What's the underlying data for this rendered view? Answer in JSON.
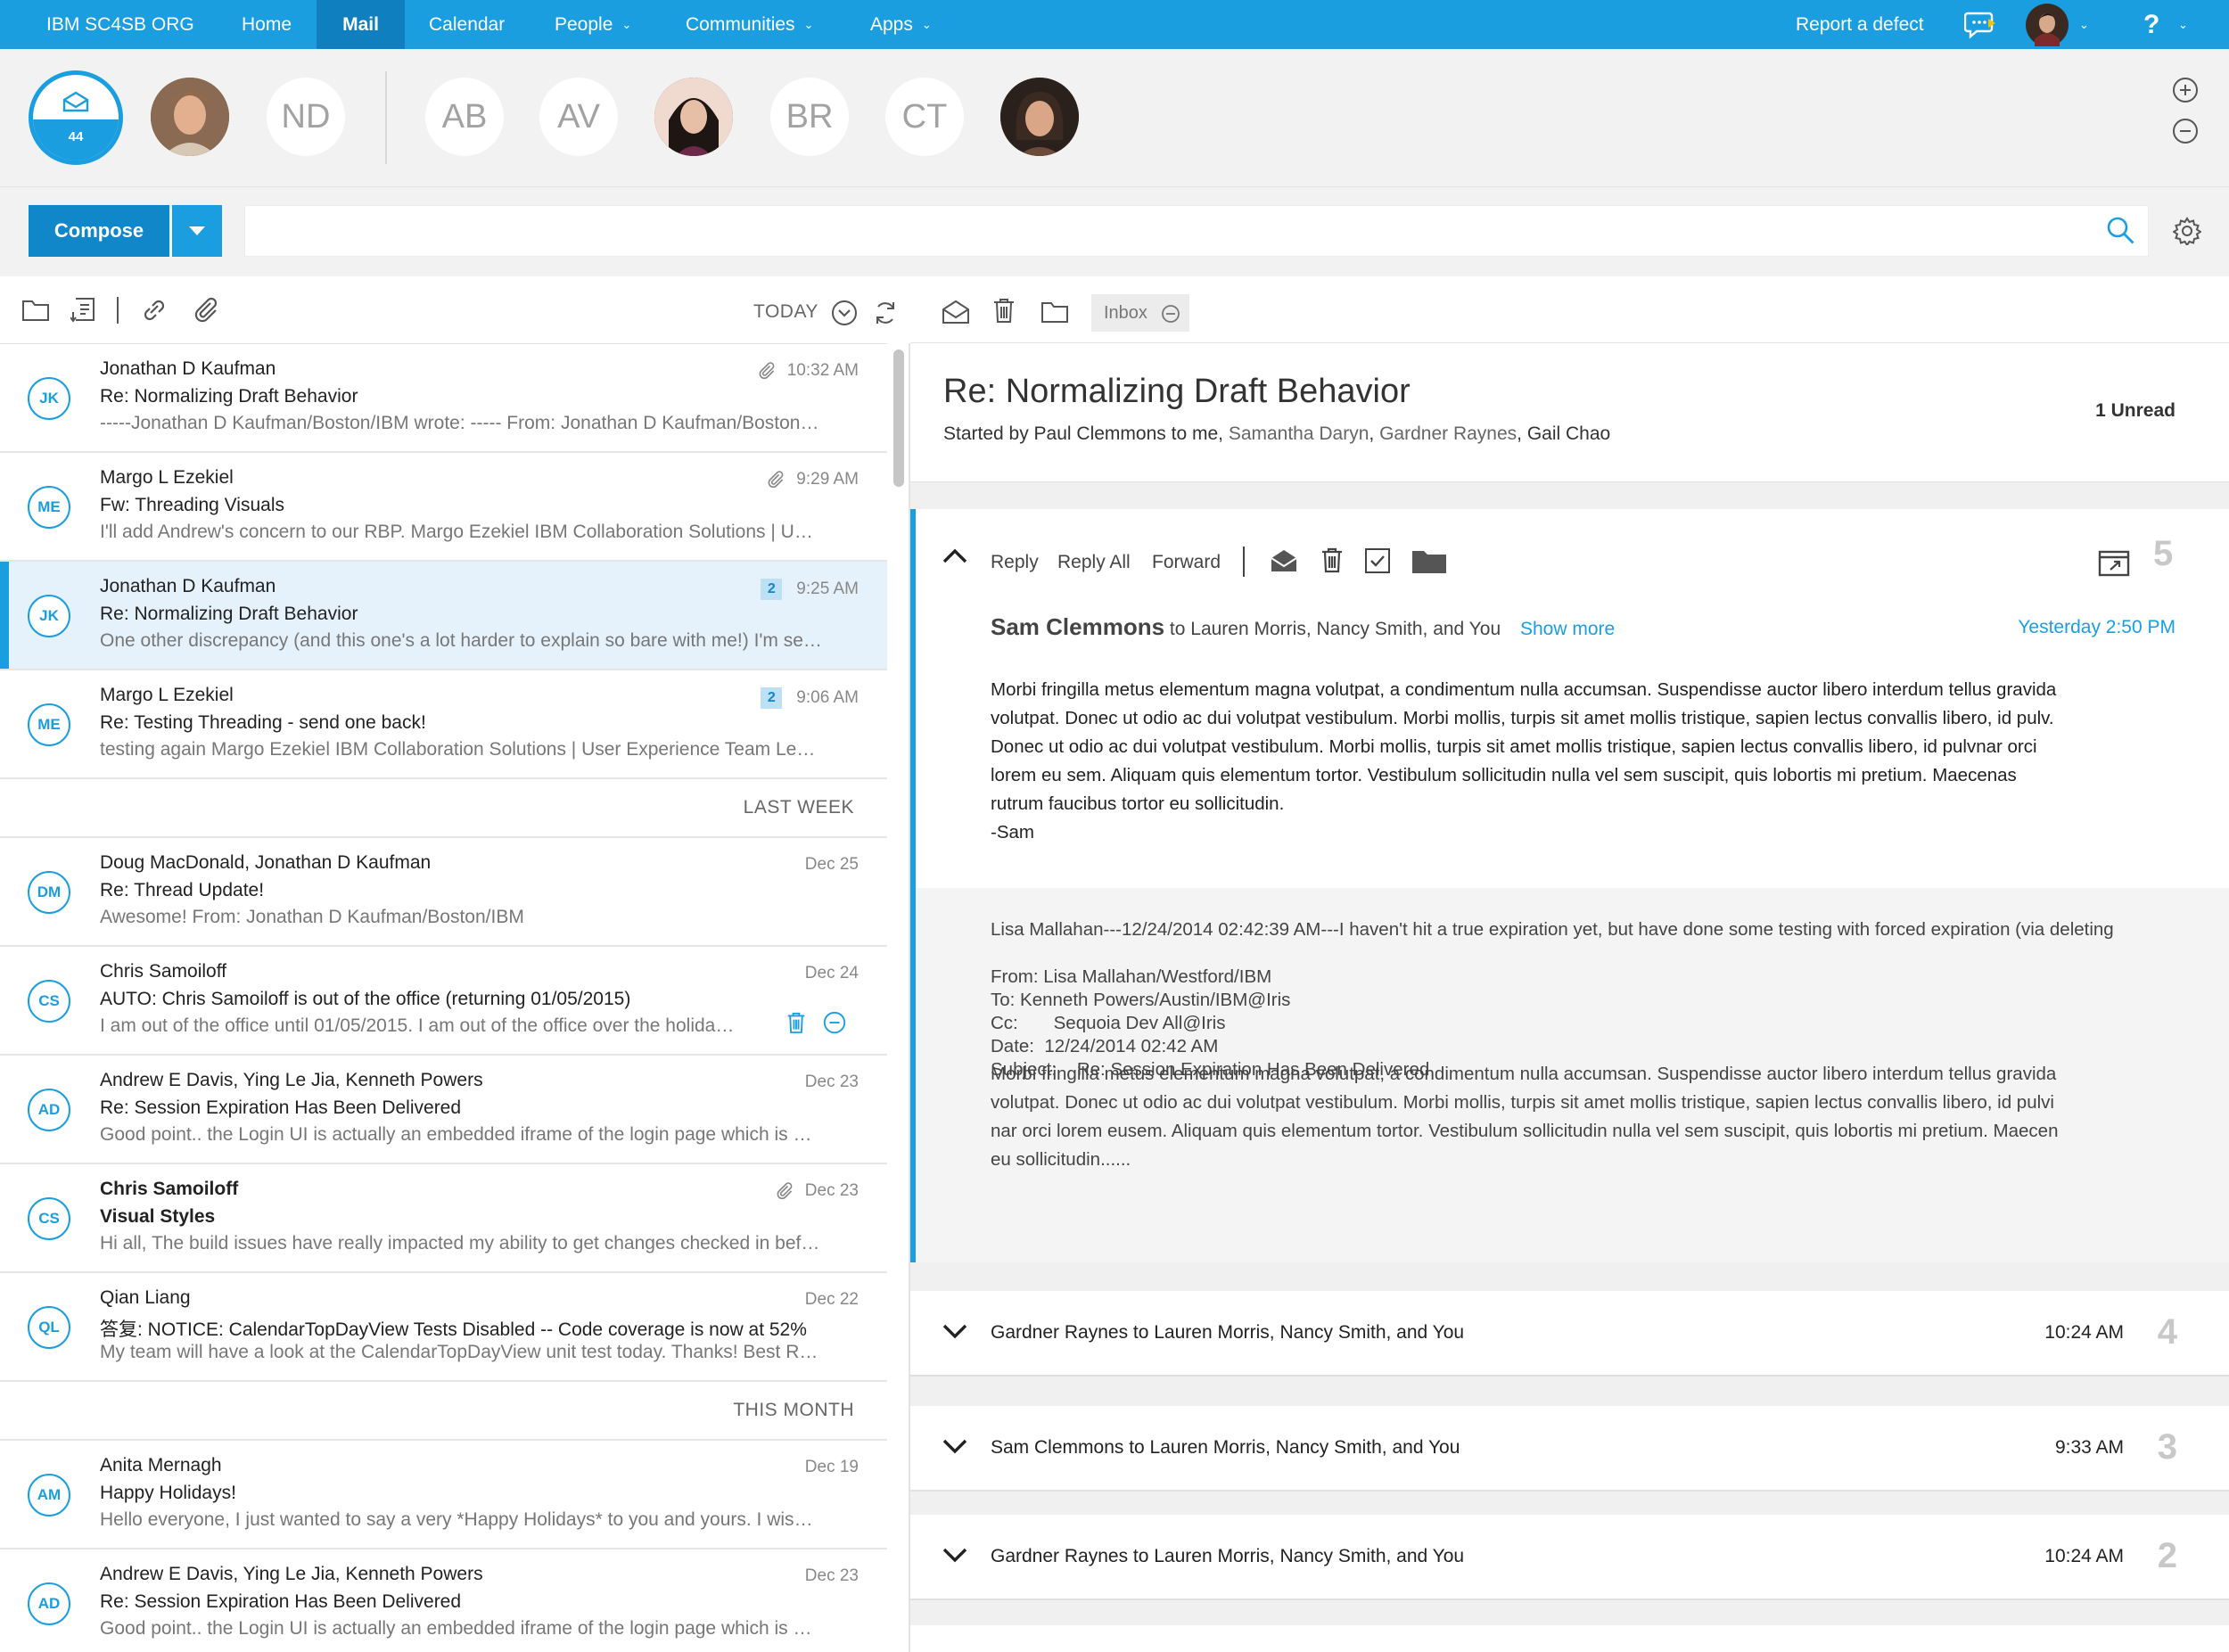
{
  "nav": {
    "org": "IBM SC4SB ORG",
    "items": [
      {
        "label": "Home"
      },
      {
        "label": "Mail"
      },
      {
        "label": "Calendar"
      },
      {
        "label": "People"
      },
      {
        "label": "Communities"
      },
      {
        "label": "Apps"
      }
    ],
    "report": "Report a defect",
    "help": "?",
    "caret": "⌄",
    "colors": {
      "bar": "#1a9ee0",
      "active": "#0f7fbf"
    }
  },
  "strip": {
    "inbox_count": "44",
    "contacts": [
      "ND",
      "AB",
      "AV",
      "BR",
      "CT"
    ]
  },
  "compose": {
    "label": "Compose"
  },
  "search": {
    "placeholder": ""
  },
  "list": {
    "filter_label": "TODAY",
    "folder": "Inbox",
    "sections": {
      "last_week": "LAST WEEK",
      "this_month": "THIS MONTH"
    },
    "rows": [
      {
        "initials": "JK",
        "from": "Jonathan D Kaufman",
        "subject": "Re: Normalizing Draft Behavior",
        "preview": "-----Jonathan D Kaufman/Boston/IBM wrote: ----- From: Jonathan D Kaufman/Boston/IBM To: Margo",
        "time": "10:32 AM"
      },
      {
        "initials": "ME",
        "from": "Margo L Ezekiel",
        "subject": "Fw: Threading Visuals",
        "preview": "I'll add Andrew's concern to our RBP. Margo Ezekiel IBM Collaboration Solutions | User Experience",
        "time": "9:29 AM"
      },
      {
        "initials": "JK",
        "from": "Jonathan D Kaufman",
        "subject": "Re: Normalizing Draft Behavior",
        "preview": "One other discrepancy (and this one's a lot harder to explain so bare with me!) I'm seeing this",
        "time": "9:25 AM",
        "count": "2"
      },
      {
        "initials": "ME",
        "from": "Margo L Ezekiel",
        "subject": "Re: Testing Threading - send one back!",
        "preview": "testing again Margo Ezekiel IBM Collaboration Solutions | User Experience Team Lead for Mail",
        "time": "9:06 AM",
        "count": "2"
      },
      {
        "initials": "DM",
        "from": "Doug MacDonald, Jonathan D Kaufman",
        "subject": "Re: Thread Update!",
        "preview": "Awesome! From: Jonathan D Kaufman/Boston/IBM",
        "time": "Dec 25"
      },
      {
        "initials": "CS",
        "from": "Chris Samoiloff",
        "subject": "AUTO: Chris Samoiloff is out of the office (returning 01/05/2015)",
        "preview": "I am out of the office until 01/05/2015. I am out of the office over the holidays and will",
        "time": "Dec 24"
      },
      {
        "initials": "AD",
        "from": "Andrew E Davis, Ying Le Jia, Kenneth Powers",
        "subject": "Re: Session Expiration Has Been Delivered",
        "preview": "Good point.. the Login UI is actually an embedded iframe of the login page which is a different",
        "time": "Dec 23"
      },
      {
        "initials": "CS",
        "from": "Chris Samoiloff",
        "subject": "Visual Styles",
        "preview": "Hi all, The build issues have really impacted my ability to get changes checked in before the",
        "time": "Dec 23"
      },
      {
        "initials": "QL",
        "from": "Qian Liang",
        "subject": "答复: NOTICE: CalendarTopDayView Tests Disabled -- Code coverage is now at 52%",
        "preview": "My team will have a look at the CalendarTopDayView unit test today. Thanks! Best Regards, Qian",
        "time": "Dec 22"
      },
      {
        "initials": "AM",
        "from": "Anita Mernagh",
        "subject": "Happy Holidays!",
        "preview": "Hello everyone, I just wanted to say a very *Happy Holidays* to you and yours. I wish you all",
        "time": "Dec 19"
      },
      {
        "initials": "AD",
        "from": "Andrew E Davis, Ying Le Jia, Kenneth Powers",
        "subject": "Re: Session Expiration Has Been Delivered",
        "preview": "Good point.. the Login UI is actually an embedded iframe of the login page which is a different",
        "time": "Dec 23"
      }
    ]
  },
  "thread": {
    "title": "Re: Normalizing Draft Behavior",
    "started_prefix": "Started by Paul Clemmons to me,",
    "others": [
      "Samantha Daryn",
      "Gardner Raynes"
    ],
    "last_participant": "Gail Chao",
    "unread": "1 Unread",
    "actions": {
      "reply": "Reply",
      "reply_all": "Reply All",
      "forward": "Forward"
    },
    "open": {
      "number": "5",
      "sender": "Sam Clemmons",
      "recipients": "to Lauren Morris, Nancy Smith, and You",
      "show_more": "Show more",
      "when": "Yesterday 2:50 PM",
      "body": [
        "Morbi fringilla metus elementum magna volutpat, a condimentum nulla accumsan. Suspendisse auctor libero interdum tellus gravida",
        "volutpat. Donec ut odio ac dui volutpat vestibulum. Morbi mollis, turpis sit amet mollis tristique, sapien lectus convallis libero, id pulv.",
        "Donec ut odio ac dui volutpat vestibulum. Morbi mollis, turpis sit amet mollis tristique, sapien lectus convallis libero, id pulvnar orci",
        "lorem eu sem. Aliquam quis elementum tortor. Vestibulum sollicitudin nulla vel sem suscipit, quis lobortis mi pretium. Maecenas",
        "rutrum faucibus tortor eu sollicitudin.",
        "-Sam"
      ],
      "quoted_first": "Lisa Mallahan---12/24/2014 02:42:39 AM---I haven't hit a true expiration yet, but have done some testing with forced expiration (via deleting",
      "quoted_headers": [
        "From:  Lisa Mallahan/Westford/IBM",
        "To: Kenneth Powers/Austin/IBM@Iris",
        "Cc:       Sequoia Dev All@Iris",
        "Date:  12/24/2014 02:42 AM",
        "Subject:    Re: Session Expiration Has Been Delivered"
      ],
      "quoted_body": [
        "Morbi fringilla metus elementum magna volutpat, a condimentum nulla accumsan. Suspendisse auctor libero interdum tellus gravida",
        "volutpat. Donec ut odio ac dui volutpat vestibulum. Morbi mollis, turpis sit amet mollis tristique, sapien lectus convallis libero, id pulvi",
        "nar orci lorem eusem. Aliquam quis elementum tortor. Vestibulum sollicitudin nulla vel sem suscipit, quis lobortis mi pretium. Maecen",
        "eu sollicitudin......"
      ]
    },
    "collapsed": [
      {
        "who": "Gardner Raynes to Lauren Morris, Nancy Smith, and You",
        "time": "10:24 AM",
        "number": "4"
      },
      {
        "who": "Sam Clemmons to Lauren Morris, Nancy Smith, and You",
        "time": "9:33 AM",
        "number": "3"
      },
      {
        "who": "Gardner Raynes to Lauren Morris, Nancy Smith, and You",
        "time": "10:24 AM",
        "number": "2"
      }
    ]
  }
}
